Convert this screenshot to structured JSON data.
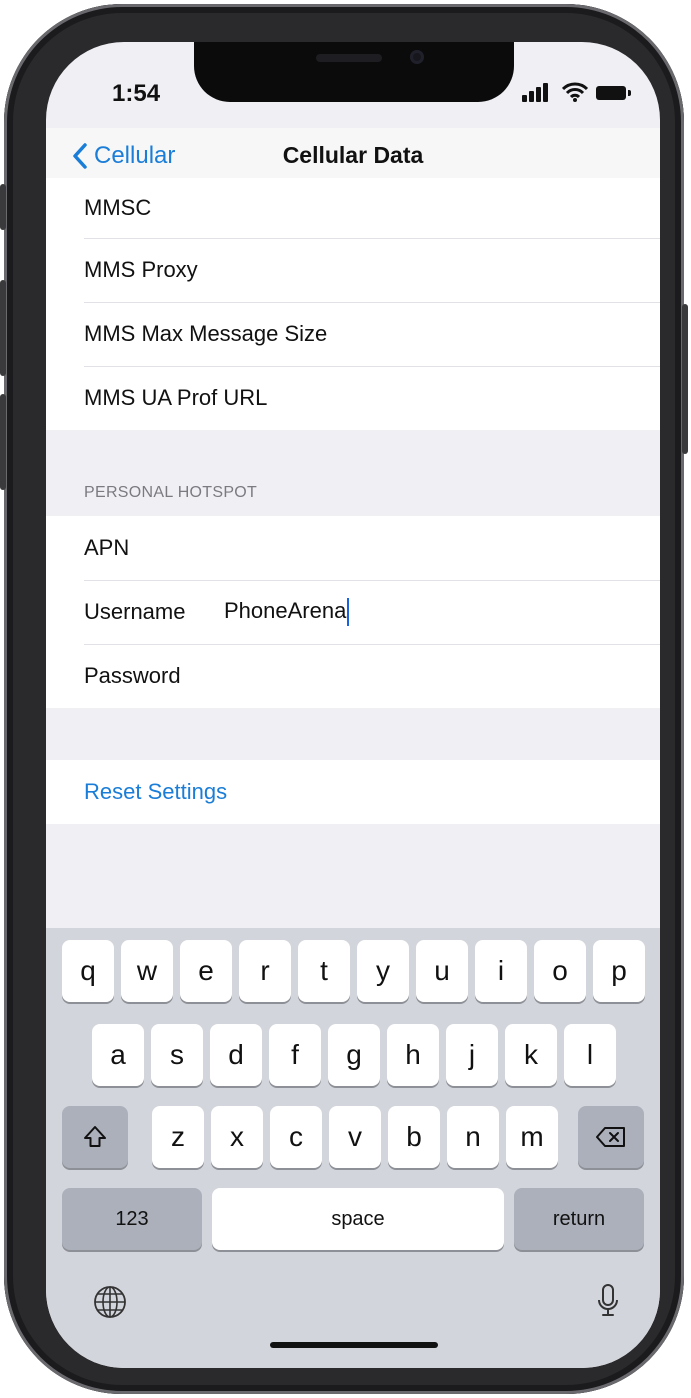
{
  "status_bar": {
    "time": "1:54"
  },
  "nav": {
    "back_label": "Cellular",
    "title": "Cellular Data"
  },
  "mms_group": {
    "rows": [
      {
        "label": "MMSC"
      },
      {
        "label": "MMS Proxy"
      },
      {
        "label": "MMS Max Message Size"
      },
      {
        "label": "MMS UA Prof URL"
      }
    ]
  },
  "hotspot_group": {
    "header": "PERSONAL HOTSPOT",
    "rows": [
      {
        "label": "APN",
        "value": ""
      },
      {
        "label": "Username",
        "value": "PhoneArena"
      },
      {
        "label": "Password",
        "value": ""
      }
    ]
  },
  "reset": {
    "label": "Reset Settings"
  },
  "keyboard": {
    "row1": [
      "q",
      "w",
      "e",
      "r",
      "t",
      "y",
      "u",
      "i",
      "o",
      "p"
    ],
    "row2": [
      "a",
      "s",
      "d",
      "f",
      "g",
      "h",
      "j",
      "k",
      "l"
    ],
    "row3": [
      "z",
      "x",
      "c",
      "v",
      "b",
      "n",
      "m"
    ],
    "numbers_label": "123",
    "space_label": "space",
    "return_label": "return"
  },
  "colors": {
    "accent": "#1a7dd7",
    "background": "#efeff4",
    "keyboard": "#d3d5dc"
  },
  "icons": [
    "chevron-left-icon",
    "signal-icon",
    "wifi-icon",
    "battery-icon",
    "shift-icon",
    "delete-icon",
    "globe-icon",
    "microphone-icon"
  ]
}
